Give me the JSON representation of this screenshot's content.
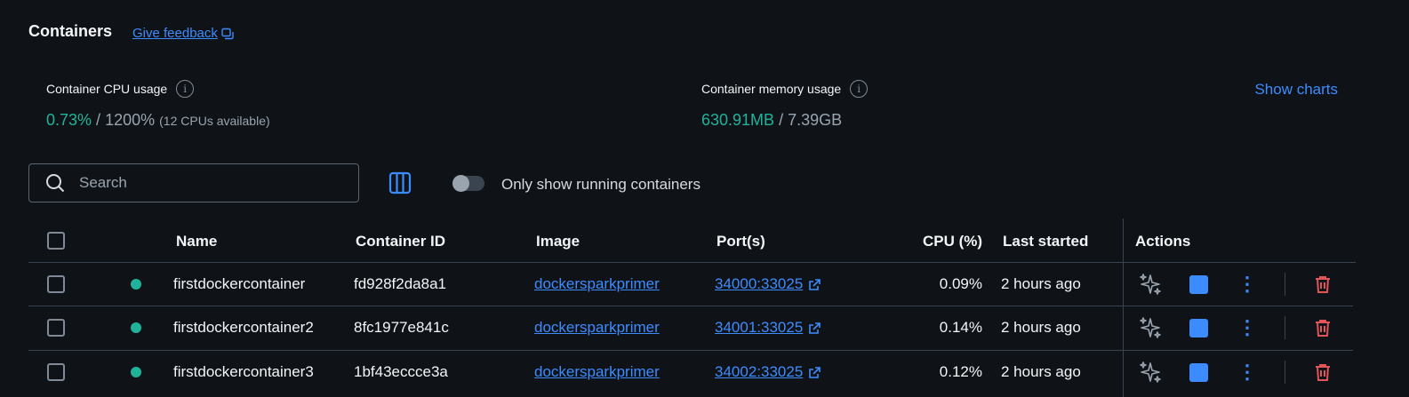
{
  "page": {
    "title": "Containers",
    "feedback_label": "Give feedback"
  },
  "stats": {
    "cpu": {
      "label": "Container CPU usage",
      "value": "0.73%",
      "separator": " / ",
      "total": "1200%",
      "note": "(12 CPUs available)"
    },
    "memory": {
      "label": "Container memory usage",
      "value": "630.91MB",
      "separator": " / ",
      "total": "7.39GB"
    },
    "show_charts_label": "Show charts"
  },
  "toolbar": {
    "search_placeholder": "Search",
    "toggle_label": "Only show running containers",
    "toggle_on": false
  },
  "table": {
    "columns": [
      "Name",
      "Container ID",
      "Image",
      "Port(s)",
      "CPU (%)",
      "Last started",
      "Actions"
    ],
    "rows": [
      {
        "name": "firstdockercontainer",
        "id": "fd928f2da8a1",
        "image": "dockersparkprimer",
        "ports": "34000:33025",
        "cpu": "0.09%",
        "started": "2 hours ago",
        "status": "running"
      },
      {
        "name": "firstdockercontainer2",
        "id": "8fc1977e841c",
        "image": "dockersparkprimer",
        "ports": "34001:33025",
        "cpu": "0.14%",
        "started": "2 hours ago",
        "status": "running"
      },
      {
        "name": "firstdockercontainer3",
        "id": "1bf43eccce3a",
        "image": "dockersparkprimer",
        "ports": "34002:33025",
        "cpu": "0.12%",
        "started": "2 hours ago",
        "status": "running"
      }
    ]
  },
  "colors": {
    "background": "#0f1318",
    "accent": "#3d8cff",
    "running": "#20b39a",
    "danger": "#e0555a"
  }
}
